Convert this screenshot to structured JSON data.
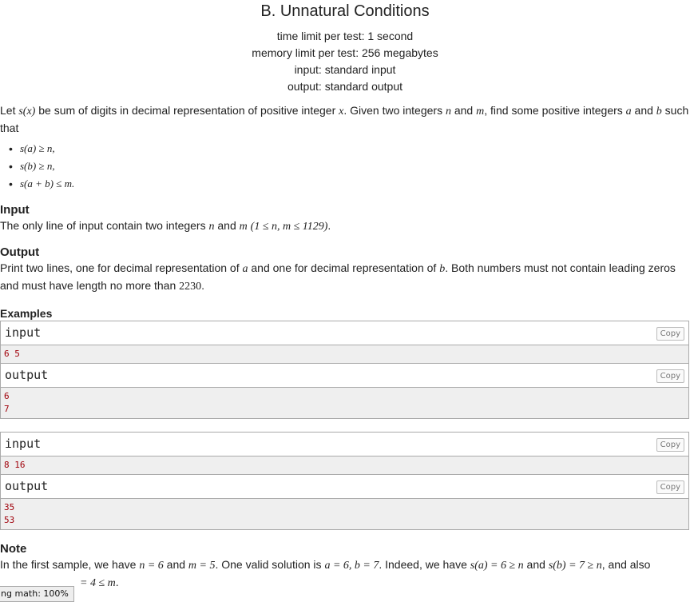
{
  "problem": {
    "title": "B. Unnatural Conditions",
    "time_limit": "time limit per test: 1 second",
    "memory_limit": "memory limit per test: 256 megabytes",
    "input_spec": "input: standard input",
    "output_spec": "output: standard output"
  },
  "legend": {
    "t1": "Let ",
    "m1": "s(x)",
    "t2": " be sum of digits in decimal representation of positive integer ",
    "m2": "x",
    "t3": ". Given two integers ",
    "m3": "n",
    "t4": " and ",
    "m4": "m",
    "t5": ", find some positive integers ",
    "m5": "a",
    "t6": " and ",
    "m6": "b",
    "t7": " such that"
  },
  "conditions": [
    "s(a) ≥ n,",
    "s(b) ≥ n,",
    "s(a + b) ≤ m."
  ],
  "input_section": {
    "title": "Input",
    "t1": "The only line of input contain two integers ",
    "m1": "n",
    "t2": " and ",
    "m2": "m",
    "t3": " ",
    "m3": "(1 ≤ n, m ≤ 1129)",
    "t4": "."
  },
  "output_section": {
    "title": "Output",
    "t1": "Print two lines, one for decimal representation of ",
    "m1": "a",
    "t2": " and one for decimal representation of ",
    "m2": "b",
    "t3": ". Both numbers must not contain leading zeros and must have length no more than ",
    "m3": "2230",
    "t4": "."
  },
  "examples": {
    "title": "Examples",
    "input_label": "input",
    "output_label": "output",
    "copy_label": "Copy",
    "tests": [
      {
        "input": [
          "6 5"
        ],
        "output": [
          "6",
          "7"
        ]
      },
      {
        "input": [
          "8 16"
        ],
        "output": [
          "35",
          "53"
        ]
      }
    ]
  },
  "note": {
    "title": "Note",
    "t1": "In the first sample, we have ",
    "m1": "n = 6",
    "t2": " and ",
    "m2": "m = 5",
    "t3": ". One valid solution is ",
    "m3": "a = 6, b = 7",
    "t4": ". Indeed, we have ",
    "m4": "s(a) = 6 ≥ n",
    "t5": " and ",
    "m5": "s(b) = 7 ≥ n",
    "t6": ", and also",
    "m6": "= 4 ≤ m",
    "t7": "."
  },
  "status_bar": {
    "text": "ng math: 100%"
  }
}
